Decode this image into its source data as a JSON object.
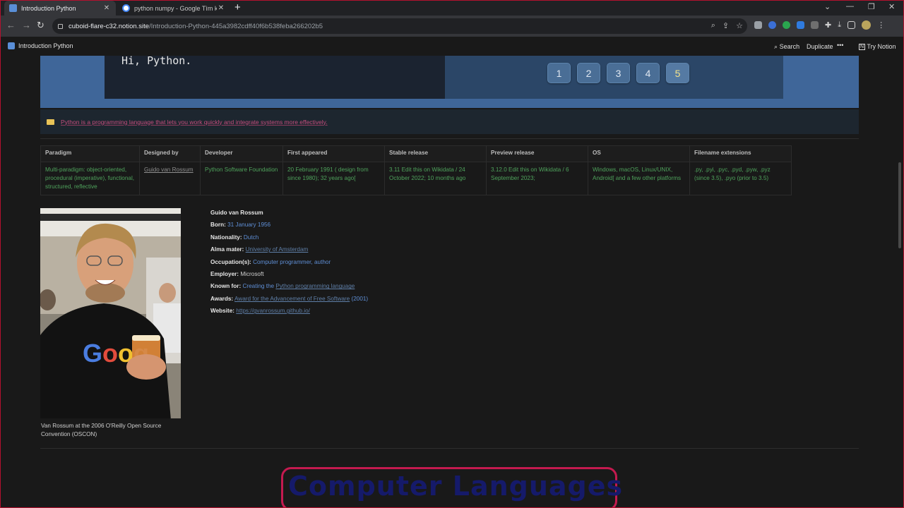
{
  "browser": {
    "tabs": [
      {
        "title": "Introduction Python",
        "active": true
      },
      {
        "title": "python numpy - Google Tìm kiế",
        "active": false
      }
    ],
    "new_tab": "+",
    "window_controls": [
      "⌄",
      "—",
      "❐",
      "✕"
    ],
    "url_host": "cuboid-flare-c32.notion.site",
    "url_path": "/Introduction-Python-445a3982cdff40f6b538feba266202b5"
  },
  "notion_bar": {
    "page_title": "Introduction Python",
    "search": "Search",
    "duplicate": "Duplicate",
    "more": "•••",
    "try_notion": "Try Notion"
  },
  "code_text": "Hi, Python.",
  "pager": [
    "1",
    "2",
    "3",
    "4",
    "5"
  ],
  "pager_active_index": 4,
  "callout_text": "Python is a programming language that lets you work quickly and integrate systems more effectively.",
  "table": {
    "headers": [
      "Paradigm",
      "Designed by",
      "Developer",
      "First appeared",
      "Stable release",
      "Preview release",
      "OS",
      "Filename extensions"
    ],
    "row": [
      "Multi-paradigm: object-oriented, procedural (imperative), functional, structured, reflective",
      "Guido van Rossum",
      "Python Software Foundation",
      "20 February 1991 ( design from since 1980); 32 years ago[",
      "3.11 Edit this on Wikidata / 24 October 2022; 10 months ago",
      "3.12.0  Edit this on Wikidata / 6 September 2023;",
      "Windows, macOS, Linux/UNIX, Android[ and a few other platforms",
      ".py, .pyi, .pyc, .pyd, .pyw, .pyz (since 3.5), .pyo (prior to 3.5)"
    ]
  },
  "photo_caption": {
    "prefix": "Van Rossum at the 2006 ",
    "link": "O'Reilly Open Source Convention",
    "suffix": " (OSCON)"
  },
  "infobox": {
    "name": "Guido van Rossum",
    "born_label": "Born:",
    "born": "31 January 1956",
    "nationality_label": "Nationality:",
    "nationality": "Dutch",
    "alma_label": "Alma mater:",
    "alma": "University of Amsterdam",
    "occupation_label": "Occupation(s):",
    "occupation": "Computer programmer, author",
    "employer_label": "Employer:",
    "employer": "Microsoft",
    "known_label": "Known for:",
    "known_prefix": "Creating the ",
    "known_link": "Python programming language",
    "awards_label": "Awards:",
    "awards_link": "Award for the Advancement of Free Software",
    "awards_year": " (2001)",
    "website_label": "Website:",
    "website": "https://gvanrossum.github.io/"
  },
  "heading": "Computer Languages",
  "colors": {
    "banner": "#3f6699",
    "callout_text": "#c34d7c",
    "table_text": "#4fa35c",
    "link": "#5f8fd6",
    "heading_border": "#c41a4f",
    "heading_text": "#151a6a"
  }
}
